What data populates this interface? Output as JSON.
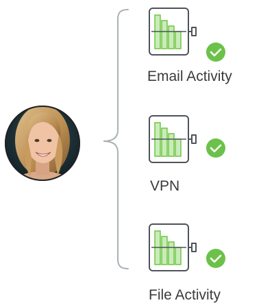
{
  "person": {
    "avatar_icon": "person-portrait-icon"
  },
  "activities": [
    {
      "label": "Email Activity",
      "chart_icon": "bar-chart-icon",
      "status_icon": "check-circle-icon",
      "status": "verified"
    },
    {
      "label": "VPN",
      "chart_icon": "bar-chart-icon",
      "status_icon": "check-circle-icon",
      "status": "verified"
    },
    {
      "label": "File Activity",
      "chart_icon": "bar-chart-icon",
      "status_icon": "check-circle-icon",
      "status": "verified"
    }
  ],
  "colors": {
    "bracket": "#a9b1b6",
    "card_stroke": "#4d5358",
    "bar_fill": "#c9ecb9",
    "bar_stroke": "#6fc545",
    "check_fill": "#6cc14a",
    "label_text": "#3a3a3a"
  }
}
